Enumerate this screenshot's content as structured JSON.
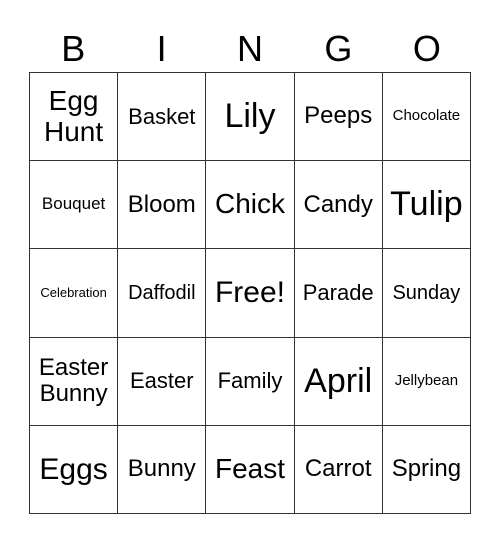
{
  "header": [
    "B",
    "I",
    "N",
    "G",
    "O"
  ],
  "cells": [
    "Egg Hunt",
    "Basket",
    "Lily",
    "Peeps",
    "Chocolate",
    "Bouquet",
    "Bloom",
    "Chick",
    "Candy",
    "Tulip",
    "Celebration",
    "Daffodil",
    "Free!",
    "Parade",
    "Sunday",
    "Easter Bunny",
    "Easter",
    "Family",
    "April",
    "Jellybean",
    "Eggs",
    "Bunny",
    "Feast",
    "Carrot",
    "Spring"
  ]
}
